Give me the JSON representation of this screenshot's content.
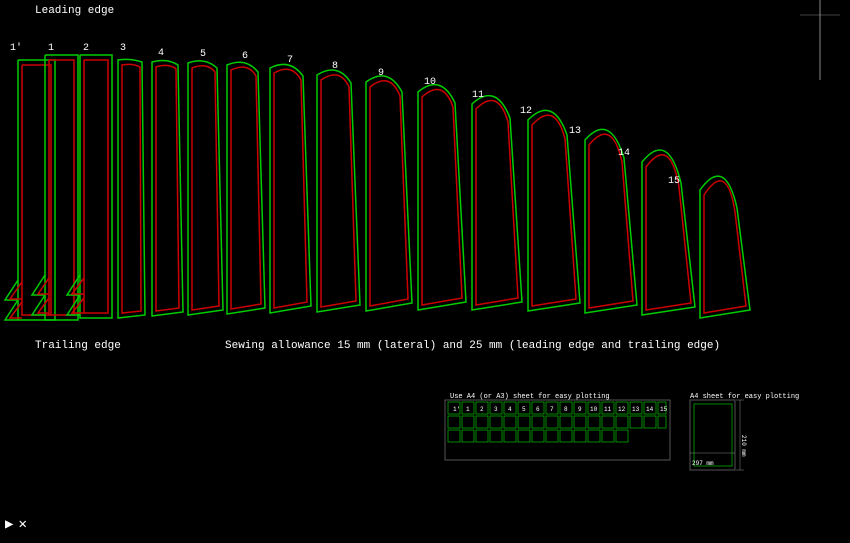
{
  "labels": {
    "leading_edge": "Leading edge",
    "trailing_edge": "Trailing edge",
    "sewing_allowance": "Sewing allowance 15 mm (lateral) and 25 mm (leading edge and trailing edge)",
    "mini_label1": "Use A4 (or A3) sheet for easy plotting",
    "mini_label2": "A4 sheet for easy plotting",
    "arrow_right": "▶",
    "cross": "✕"
  },
  "panel_numbers": [
    "1'",
    "1",
    "2",
    "3",
    "4",
    "5",
    "6",
    "7",
    "8",
    "9",
    "10",
    "11",
    "12",
    "13",
    "14",
    "15"
  ],
  "colors": {
    "background": "#000000",
    "outer_line": "#00cc00",
    "inner_line": "#cc0000",
    "text": "#ffffff",
    "dim_line": "#ffffff"
  }
}
